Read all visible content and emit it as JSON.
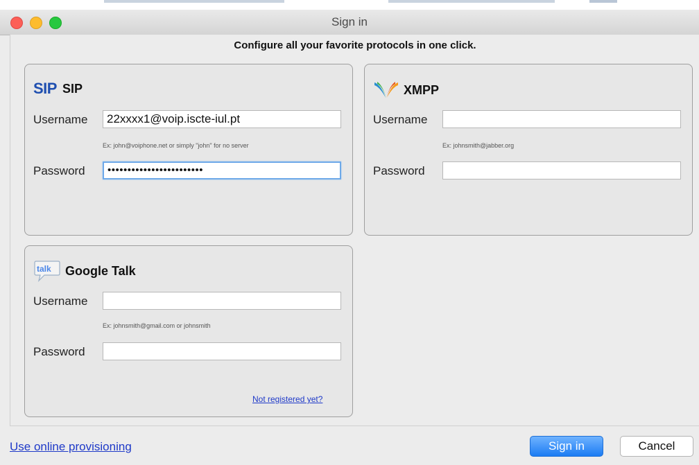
{
  "window": {
    "title": "Sign in",
    "heading": "Configure all your favorite protocols in one click."
  },
  "sip": {
    "title": "SIP",
    "icon_text": "SIP",
    "username_label": "Username",
    "username_value": "22xxxx1@voip.iscte-iul.pt",
    "username_hint": "Ex: john@voiphone.net or simply \"john\" for no server",
    "password_label": "Password",
    "password_value": "••••••••••••••••••••••••"
  },
  "xmpp": {
    "title": "XMPP",
    "username_label": "Username",
    "username_value": "",
    "username_hint": "Ex: johnsmith@jabber.org",
    "password_label": "Password",
    "password_value": ""
  },
  "google_talk": {
    "title": "Google Talk",
    "icon_text": "talk",
    "username_label": "Username",
    "username_value": "",
    "username_hint": "Ex: johnsmith@gmail.com or johnsmith",
    "password_label": "Password",
    "password_value": "",
    "register_link": "Not registered yet?"
  },
  "footer": {
    "provisioning_link": "Use online provisioning",
    "sign_in_label": "Sign in",
    "cancel_label": "Cancel"
  },
  "colors": {
    "accent": "#1b7cf3",
    "link": "#1e39c8",
    "sip_blue": "#1f4fb0"
  }
}
